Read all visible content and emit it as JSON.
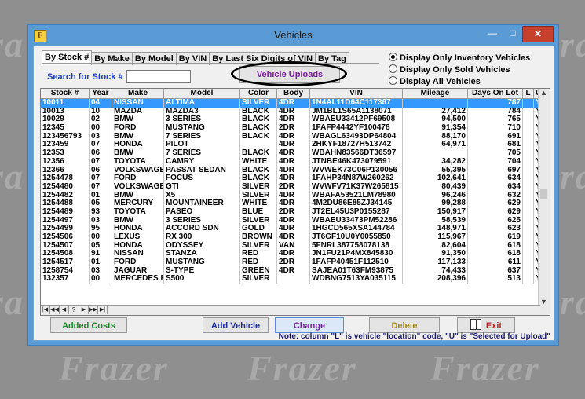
{
  "window": {
    "title": "Vehicles",
    "app_icon_letter": "F"
  },
  "tabs": [
    {
      "label": "By Stock #",
      "active": true
    },
    {
      "label": "By Make",
      "active": false
    },
    {
      "label": "By Model",
      "active": false
    },
    {
      "label": "By VIN",
      "active": false
    },
    {
      "label": "By Last Six Digits of VIN",
      "active": false
    },
    {
      "label": "By Tag",
      "active": false
    }
  ],
  "search": {
    "label": "Search for Stock #",
    "value": ""
  },
  "upload_button": "Vehicle Uploads",
  "filters": [
    {
      "label": "Display Only Inventory Vehicles",
      "selected": true
    },
    {
      "label": "Display Only Sold Vehicles",
      "selected": false
    },
    {
      "label": "Display All Vehicles",
      "selected": false
    }
  ],
  "table": {
    "columns": [
      "Stock #",
      "Year",
      "Make",
      "Model",
      "Color",
      "Body",
      "VIN",
      "Mileage",
      "Days On Lot",
      "L",
      "U"
    ],
    "rows": [
      [
        "10011",
        "04",
        "NISSAN",
        "ALTIMA",
        "SILVER",
        "4DR",
        "1N4AL11D64C117367",
        "",
        "787",
        "",
        "Y"
      ],
      [
        "10013",
        "10",
        "MAZDA",
        "MAZDA3",
        "BLACK",
        "4DR",
        "JM1BL1S65A1138071",
        "27,412",
        "784",
        "",
        "Y"
      ],
      [
        "10029",
        "02",
        "BMW",
        "3 SERIES",
        "BLACK",
        "4DR",
        "WBAEU33412PF69508",
        "94,500",
        "765",
        "",
        "Y"
      ],
      [
        "12345",
        "00",
        "FORD",
        "MUSTANG",
        "BLACK",
        "2DR",
        "1FAFP4442YF100478",
        "91,354",
        "710",
        "",
        "Y"
      ],
      [
        "123456793",
        "03",
        "BMW",
        "7 SERIES",
        "BLACK",
        "4DR",
        "WBAGL63493DP64804",
        "88,170",
        "691",
        "",
        "Y"
      ],
      [
        "123459",
        "07",
        "HONDA",
        "PILOT",
        "",
        "4DR",
        "2HKYF18727H513742",
        "64,971",
        "681",
        "",
        "Y"
      ],
      [
        "12353",
        "06",
        "BMW",
        "7 SERIES",
        "BLACK",
        "4DR",
        "WBAHN83566DT36597",
        "",
        "705",
        "",
        "Y"
      ],
      [
        "12356",
        "07",
        "TOYOTA",
        "CAMRY",
        "WHITE",
        "4DR",
        "JTNBE46K473079591",
        "34,282",
        "704",
        "",
        "Y"
      ],
      [
        "12366",
        "06",
        "VOLKSWAGE",
        "PASSAT SEDAN",
        "BLACK",
        "4DR",
        "WVWEK73C06P130056",
        "55,395",
        "697",
        "",
        "Y"
      ],
      [
        "1254478",
        "07",
        "FORD",
        "FOCUS",
        "BLACK",
        "4DR",
        "1FAHP34N87W260262",
        "102,641",
        "634",
        "",
        "Y"
      ],
      [
        "1254480",
        "07",
        "VOLKSWAGE",
        "GTI",
        "SILVER",
        "2DR",
        "WVWFV71K37W265815",
        "80,439",
        "634",
        "",
        "Y"
      ],
      [
        "1254482",
        "01",
        "BMW",
        "X5",
        "SILVER",
        "4DR",
        "WBAFA53521LM78980",
        "96,246",
        "632",
        "",
        "Y"
      ],
      [
        "1254488",
        "05",
        "MERCURY",
        "MOUNTAINEER",
        "WHITE",
        "4DR",
        "4M2DU86E85ZJ34145",
        "99,288",
        "629",
        "",
        "Y"
      ],
      [
        "1254489",
        "93",
        "TOYOTA",
        "PASEO",
        "BLUE",
        "2DR",
        "JT2EL45U3P0155287",
        "150,917",
        "629",
        "",
        "Y"
      ],
      [
        "1254497",
        "03",
        "BMW",
        "3 SERIES",
        "SILVER",
        "4DR",
        "WBAEU33473PM52286",
        "58,539",
        "625",
        "",
        "Y"
      ],
      [
        "1254499",
        "95",
        "HONDA",
        "ACCORD SDN",
        "GOLD",
        "4DR",
        "1HGCD565XSA144784",
        "148,971",
        "623",
        "",
        "Y"
      ],
      [
        "1254506",
        "00",
        "LEXUS",
        "RX 300",
        "BROWN",
        "4DR",
        "JT6GF10U0Y0055850",
        "115,967",
        "619",
        "",
        "Y"
      ],
      [
        "1254507",
        "05",
        "HONDA",
        "ODYSSEY",
        "SILVER",
        "VAN",
        "5FNRL387758078138",
        "82,604",
        "618",
        "",
        "Y"
      ],
      [
        "1254508",
        "91",
        "NISSAN",
        "STANZA",
        "RED",
        "4DR",
        "JN1FU21P4MX845830",
        "91,350",
        "618",
        "",
        "Y"
      ],
      [
        "1254517",
        "01",
        "FORD",
        "MUSTANG",
        "RED",
        "2DR",
        "1FAFP40451F112510",
        "117,133",
        "611",
        "",
        "Y"
      ],
      [
        "1258754",
        "03",
        "JAGUAR",
        "S-TYPE",
        "GREEN",
        "4DR",
        "SAJEA01T63FM93875",
        "74,433",
        "637",
        "",
        "Y"
      ],
      [
        "132357",
        "00",
        "MERCEDES E",
        "S500",
        "SILVER",
        "",
        "WDBNG7513YA035115",
        "208,396",
        "513",
        "",
        "Y"
      ]
    ]
  },
  "nav_buttons": [
    "|◀",
    "◀◀",
    "◀",
    "?",
    "▶",
    "▶▶",
    "▶|"
  ],
  "buttons": {
    "added_costs": "Added Costs",
    "add_vehicle": "Add Vehicle",
    "change": "Change",
    "delete": "Delete",
    "exit": "Exit"
  },
  "note": "Note: column \"L\" is vehicle \"location\" code, \"U\" is \"Selected for Upload\"",
  "watermark": [
    "Frazer",
    "Frazer",
    "Frazer"
  ]
}
